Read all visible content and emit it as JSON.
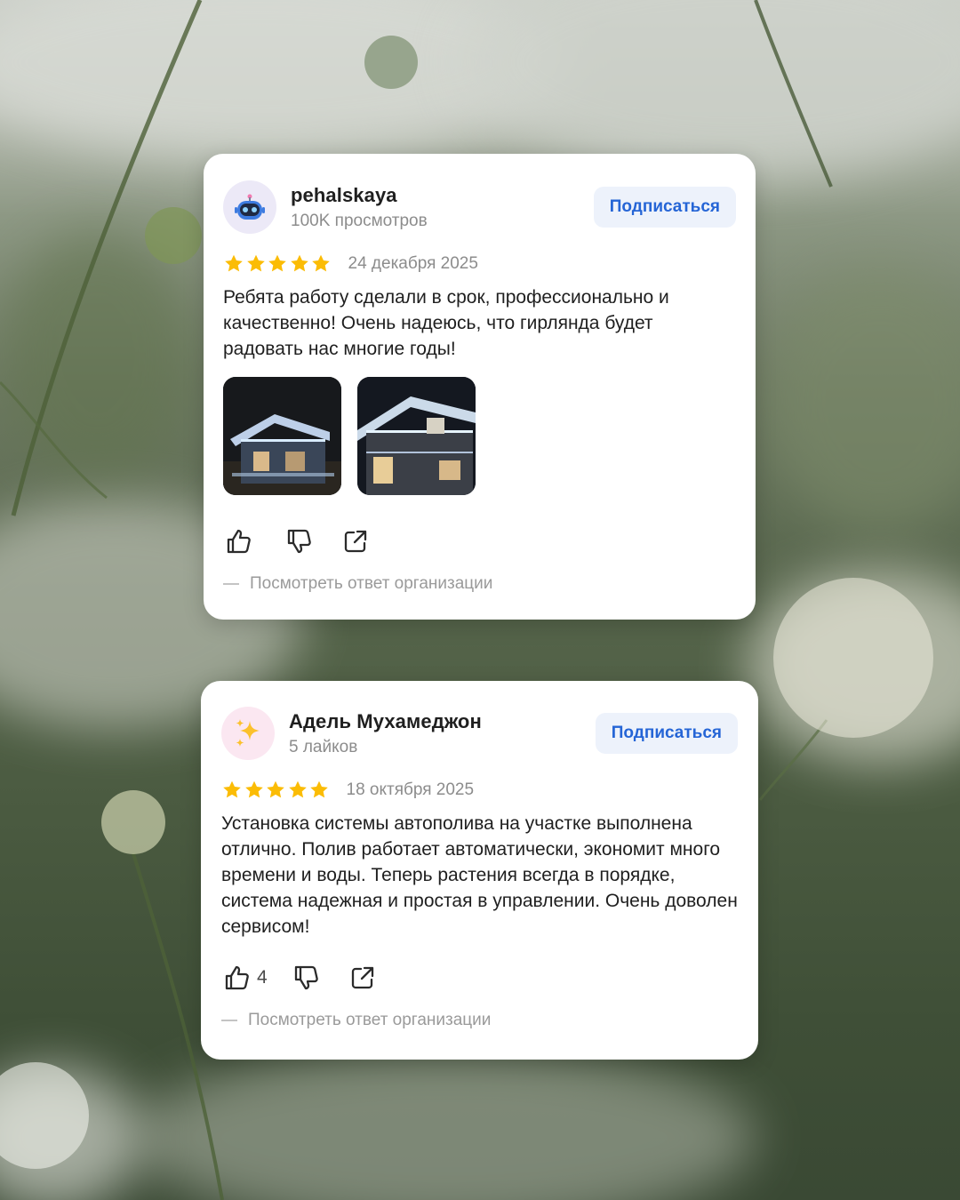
{
  "colors": {
    "star": "#fbbc05",
    "subscribe_bg": "#edf2fb",
    "subscribe_text": "#2565d6",
    "muted_text": "#8c8c8c"
  },
  "reviews": [
    {
      "author": "pehalskaya",
      "meta": "100K просмотров",
      "avatar_icon": "robot-face-icon",
      "subscribe_label": "Подписаться",
      "rating": 5,
      "date": "24 декабря 2025",
      "text": "Ребята работу сделали в срок, профессионально и качественно! Очень надеюсь, что гирлянда будет радовать нас многие годы!",
      "photos": [
        "house-with-garland-photo-1",
        "house-with-garland-photo-2"
      ],
      "like_count": "",
      "org_reply_label": "Посмотреть ответ организации"
    },
    {
      "author": "Адель Мухамеджон",
      "meta": "5 лайков",
      "avatar_icon": "sparkles-icon",
      "subscribe_label": "Подписаться",
      "rating": 5,
      "date": "18 октября 2025",
      "text": "Установка системы автополива на участке выполнена отлично. Полив работает автоматически, экономит много времени и воды. Теперь растения всегда в порядке, система надежная и простая в управлении. Очень доволен сервисом!",
      "photos": [],
      "like_count": "4",
      "org_reply_label": "Посмотреть ответ организации"
    }
  ]
}
